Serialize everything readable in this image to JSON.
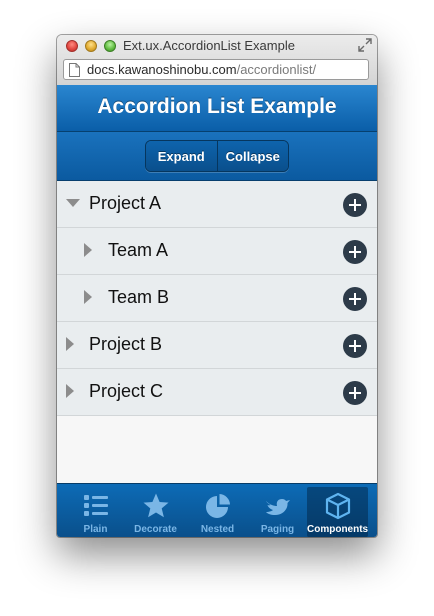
{
  "window": {
    "title": "Ext.ux.AccordionList Example",
    "url_host": "docs.kawanoshinobu.com",
    "url_path": "/accordionlist/"
  },
  "header": {
    "title": "Accordion List Example"
  },
  "toolbar": {
    "expand_label": "Expand",
    "collapse_label": "Collapse"
  },
  "list": {
    "rows": [
      {
        "label": "Project A",
        "level": 0,
        "expanded": true
      },
      {
        "label": "Team A",
        "level": 1,
        "expanded": false
      },
      {
        "label": "Team B",
        "level": 1,
        "expanded": false
      },
      {
        "label": "Project B",
        "level": 0,
        "expanded": false
      },
      {
        "label": "Project C",
        "level": 0,
        "expanded": false
      }
    ],
    "add_icon": "plus-circle-icon"
  },
  "tabs": [
    {
      "label": "Plain",
      "icon": "list-icon",
      "active": false
    },
    {
      "label": "Decorate",
      "icon": "star-icon",
      "active": false
    },
    {
      "label": "Nested",
      "icon": "pie-chart-icon",
      "active": false
    },
    {
      "label": "Paging",
      "icon": "bird-icon",
      "active": false
    },
    {
      "label": "Components",
      "icon": "cube-icon",
      "active": true
    }
  ],
  "colors": {
    "header_blue": "#0a5ea8",
    "tab_inactive": "#7ab6e6",
    "add_button": "#2d3b49"
  }
}
